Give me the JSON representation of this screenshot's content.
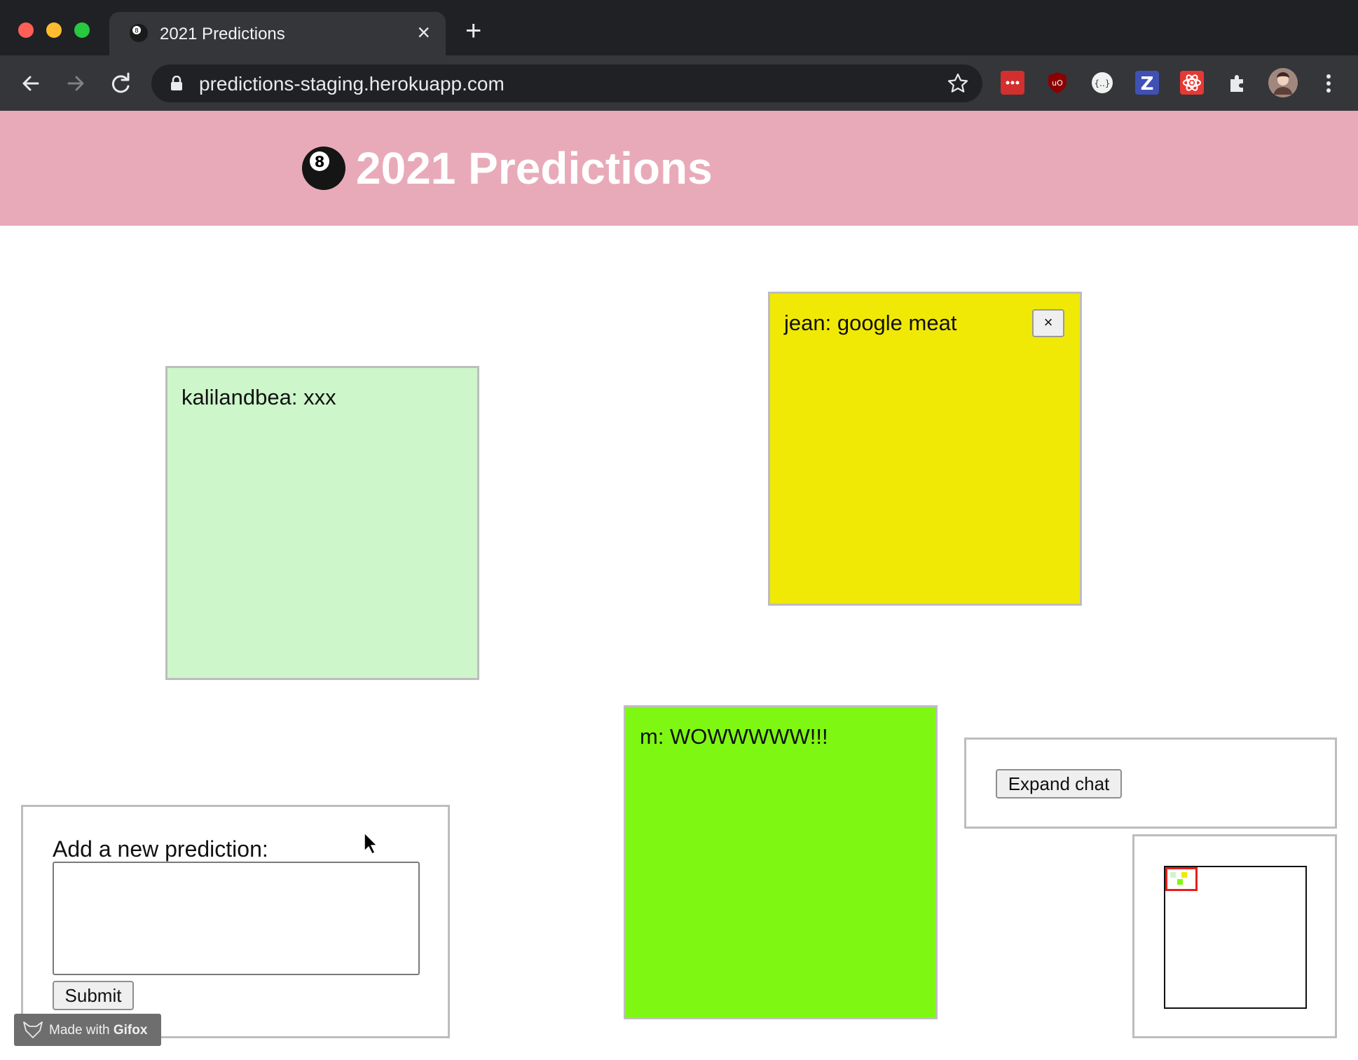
{
  "browser": {
    "tab_title": "2021 Predictions",
    "url": "predictions-staging.herokuapp.com",
    "icons": [
      "back-icon",
      "forward-icon",
      "reload-icon",
      "lock-icon",
      "star-icon",
      "lastpass-icon",
      "ublock-icon",
      "json-icon",
      "zotero-icon",
      "react-devtools-icon",
      "extensions-icon",
      "profile-avatar",
      "menu-icon"
    ]
  },
  "header": {
    "title": "2021 Predictions",
    "icon": "8-ball-icon",
    "background": "#e8aab9"
  },
  "predictions": [
    {
      "text": "kalilandbea: xxx",
      "color": "#cdf6ca",
      "has_close": false
    },
    {
      "text": "jean: google meat",
      "color": "#f0e906",
      "has_close": true,
      "close_label": "×"
    },
    {
      "text": "m: WOWWWWW!!!",
      "color": "#7ef812",
      "has_close": false
    }
  ],
  "form": {
    "label": "Add a new prediction:",
    "textarea_value": "",
    "submit_label": "Submit"
  },
  "chat": {
    "expand_label": "Expand chat"
  },
  "watermark": {
    "prefix": "Made with ",
    "brand": "Gifox"
  }
}
